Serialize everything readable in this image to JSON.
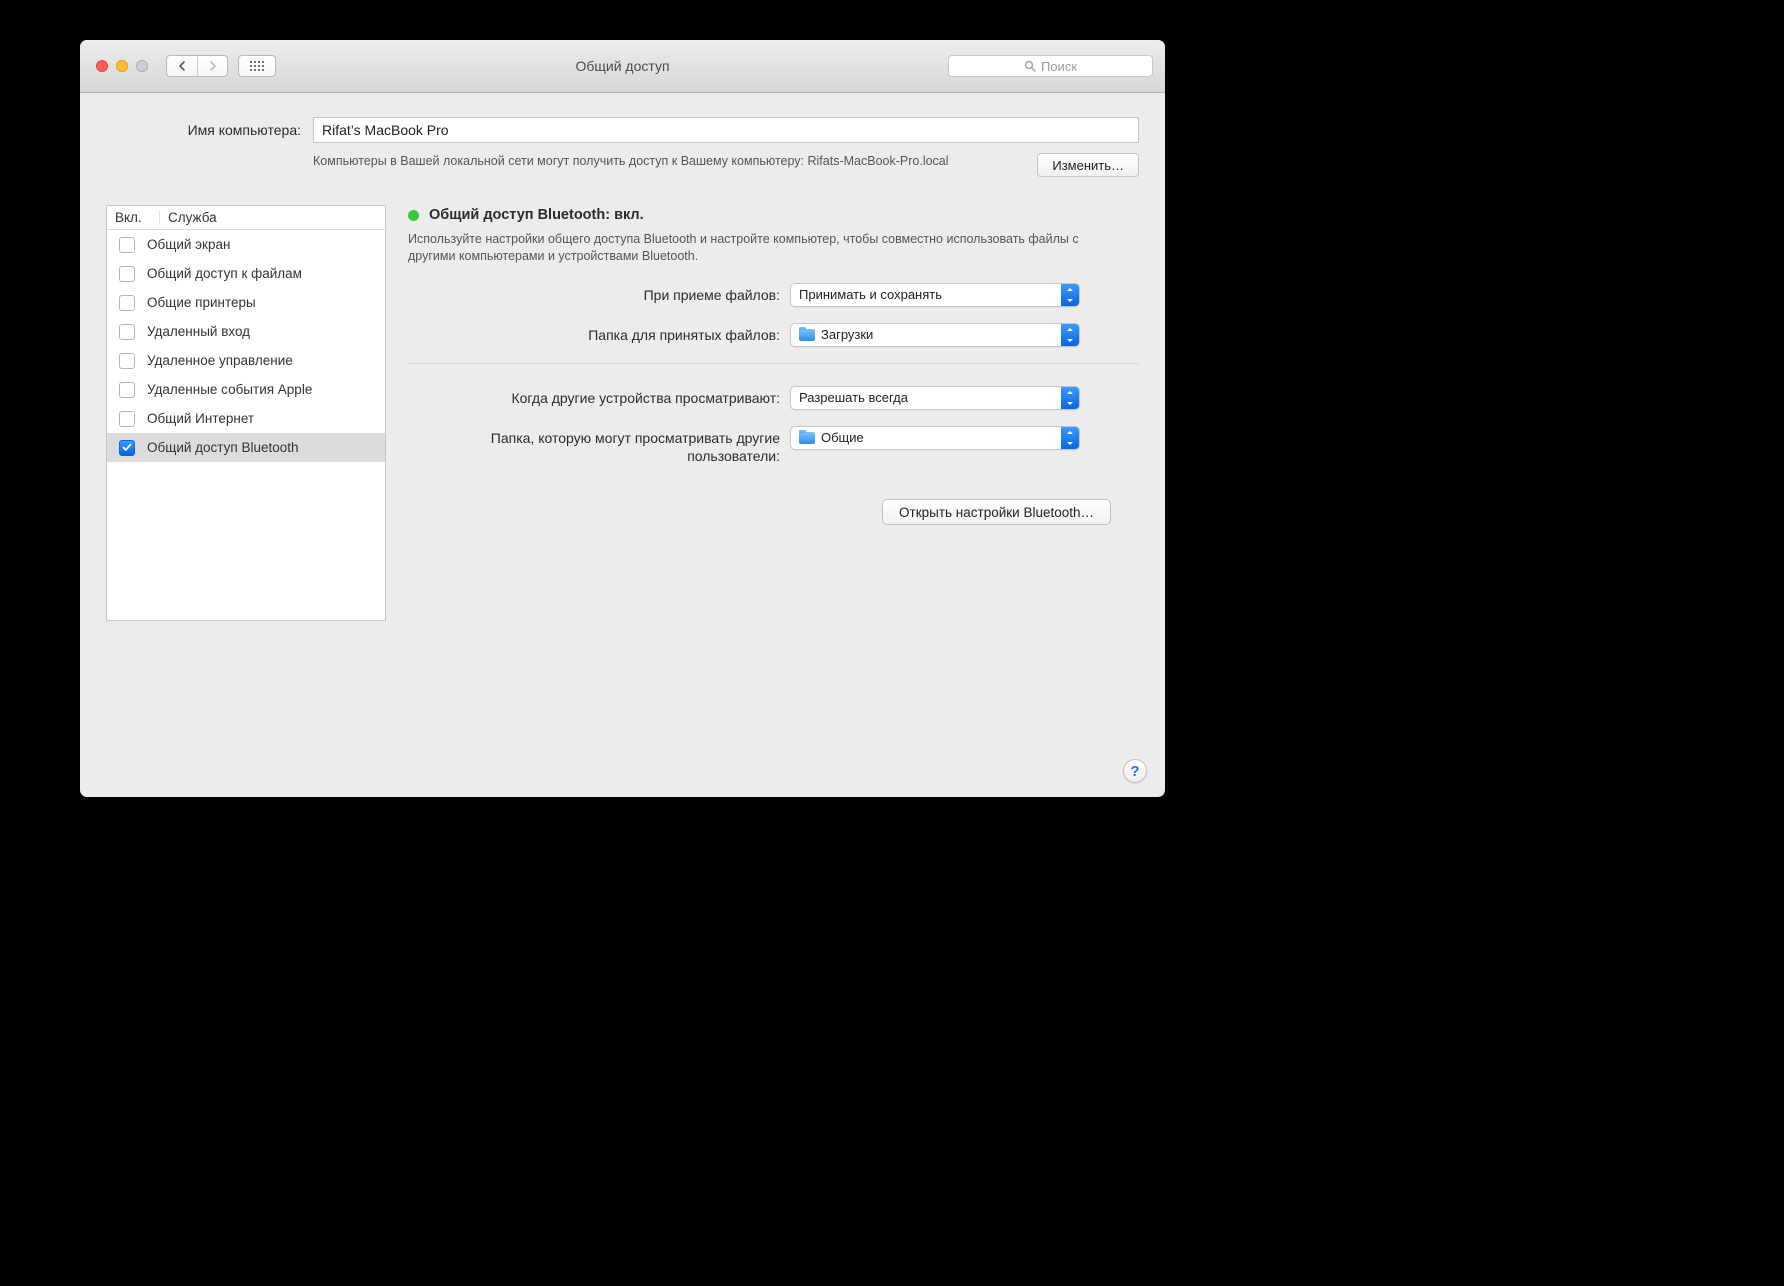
{
  "titlebar": {
    "title": "Общий доступ",
    "search_placeholder": "Поиск"
  },
  "header": {
    "computer_name_label": "Имя компьютера:",
    "computer_name_value": "Rifat’s MacBook Pro",
    "description": "Компьютеры в Вашей локальной сети могут получить доступ к Вашему компьютеру: Rifats-MacBook-Pro.local",
    "edit_button": "Изменить…"
  },
  "services": {
    "col_on": "Вкл.",
    "col_service": "Служба",
    "items": [
      {
        "on": false,
        "label": "Общий экран"
      },
      {
        "on": false,
        "label": "Общий доступ к файлам"
      },
      {
        "on": false,
        "label": "Общие принтеры"
      },
      {
        "on": false,
        "label": "Удаленный вход"
      },
      {
        "on": false,
        "label": "Удаленное управление"
      },
      {
        "on": false,
        "label": "Удаленные события Apple"
      },
      {
        "on": false,
        "label": "Общий Интернет"
      },
      {
        "on": true,
        "label": "Общий доступ Bluetooth"
      }
    ],
    "selected_index": 7
  },
  "detail": {
    "status_text": "Общий доступ Bluetooth: вкл.",
    "description": "Используйте настройки общего доступа Bluetooth и настройте компьютер, чтобы совместно использовать файлы с другими компьютерами и устройствами Bluetooth.",
    "recv_label": "При приеме файлов:",
    "recv_value": "Принимать и сохранять",
    "recv_folder_label": "Папка для принятых файлов:",
    "recv_folder_value": "Загрузки",
    "browse_label": "Когда другие устройства просматривают:",
    "browse_value": "Разрешать всегда",
    "browse_folder_label": "Папка, которую могут просматривать другие пользователи:",
    "browse_folder_value": "Общие",
    "open_bt_button": "Открыть настройки Bluetooth…"
  },
  "help": "?"
}
